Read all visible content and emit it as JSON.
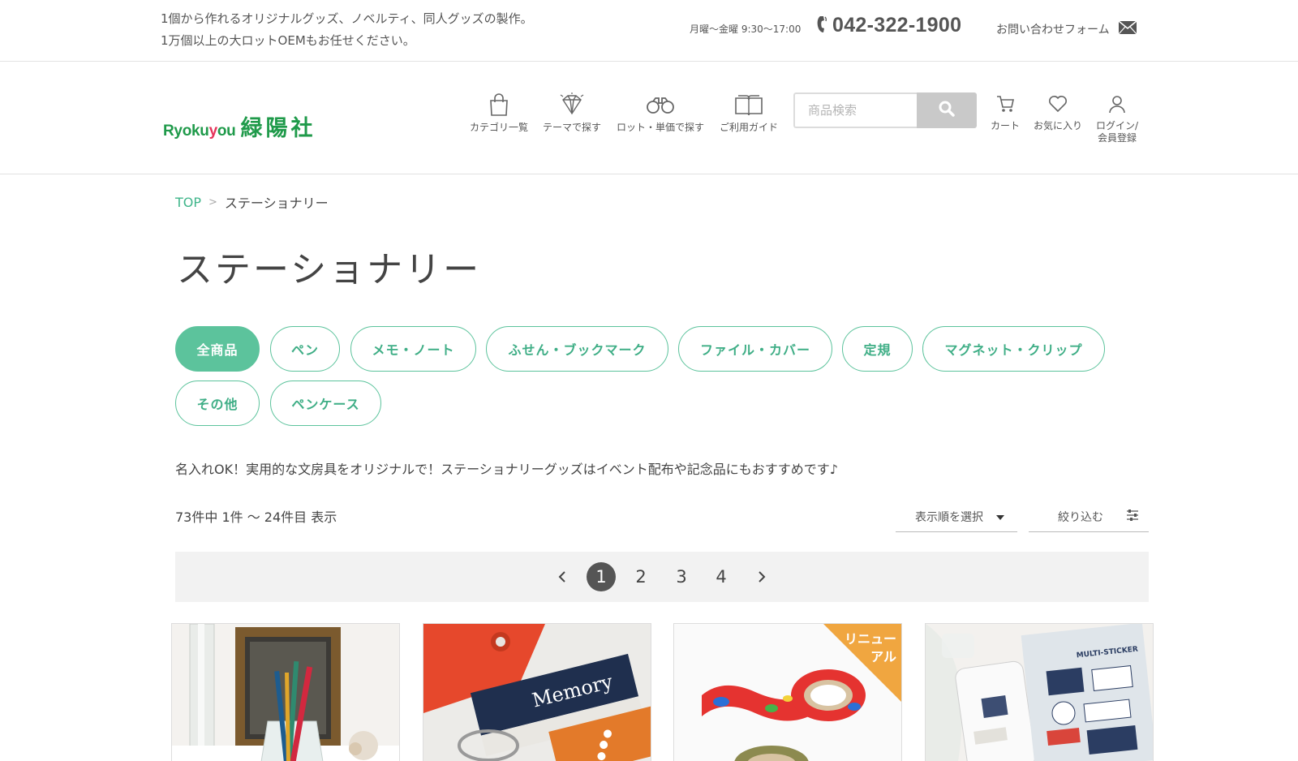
{
  "topbar": {
    "tagline": [
      "1個から作れるオリジナルグッズ、ノベルティ、同人グッズの製作。",
      "1万個以上の大ロットOEMもお任せください。"
    ],
    "hours": "月曜〜金曜 9:30〜17:00",
    "phone": "042-322-1900",
    "contact_label": "お問い合わせフォーム"
  },
  "header": {
    "logo_en_1": "Ryoku",
    "logo_en_2": "y",
    "logo_en_3": "ou",
    "logo_jp": "緑陽社",
    "nav": [
      {
        "label": "カテゴリ一覧",
        "icon": "bag-icon"
      },
      {
        "label": "テーマで探す",
        "icon": "diamond-icon"
      },
      {
        "label": "ロット・単価で探す",
        "icon": "binoculars-icon"
      },
      {
        "label": "ご利用ガイド",
        "icon": "book-icon"
      }
    ],
    "search_placeholder": "商品検索",
    "utils": [
      {
        "label": "カート",
        "icon": "cart-icon"
      },
      {
        "label": "お気に入り",
        "icon": "heart-icon"
      },
      {
        "label": "ログイン/\n会員登録",
        "icon": "user-icon"
      }
    ]
  },
  "breadcrumb": {
    "top": "TOP",
    "sep": ">",
    "current": "ステーショナリー"
  },
  "page_title": "ステーショナリー",
  "categories": [
    {
      "label": "全商品",
      "active": true
    },
    {
      "label": "ペン",
      "active": false
    },
    {
      "label": "メモ・ノート",
      "active": false
    },
    {
      "label": "ふせん・ブックマーク",
      "active": false
    },
    {
      "label": "ファイル・カバー",
      "active": false
    },
    {
      "label": "定規",
      "active": false
    },
    {
      "label": "マグネット・クリップ",
      "active": false
    },
    {
      "label": "その他",
      "active": false
    },
    {
      "label": "ペンケース",
      "active": false
    }
  ],
  "description": "名入れOK！実用的な文房具をオリジナルで！ステーショナリーグッズはイベント配布や記念品にもおすすめです♪",
  "result_count": "73件中 1件 〜 24件目 表示",
  "sort_label": "表示順を選択",
  "filter_label": "絞り込む",
  "pagination": {
    "prev": "‹",
    "pages": [
      "1",
      "2",
      "3",
      "4"
    ],
    "current": "1",
    "next": "›"
  },
  "products": [
    {
      "image": "pens-in-glass-photo"
    },
    {
      "image": "memory-wordbook-photo",
      "label_text": "Memory"
    },
    {
      "image": "masking-tape-photo",
      "badge": "リニュー\nアル"
    },
    {
      "image": "multi-sticker-photo",
      "label_text": "MULTI-STICKER"
    }
  ],
  "colors": {
    "brand_green": "#1f9a4a",
    "accent_mint": "#5cc39c",
    "badge_orange": "#f0a640"
  }
}
